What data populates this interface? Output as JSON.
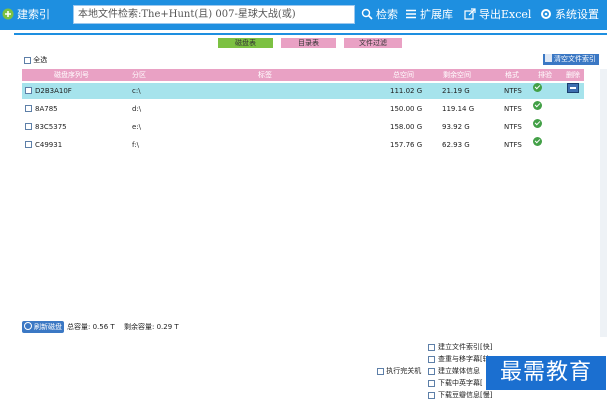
{
  "toolbar": {
    "build_index_label": "建索引",
    "search_value": "本地文件检索:The+Hunt(且) 007-星球大战(或)",
    "search_label": "检索",
    "extensions_label": "扩展库",
    "export_excel_label": "导出Excel",
    "settings_label": "系统设置"
  },
  "tabs": [
    {
      "label": "磁盘表",
      "color": "#7cc142"
    },
    {
      "label": "目录表",
      "color": "#e9a1c4"
    },
    {
      "label": "文件过滤",
      "color": "#e9a1c4"
    }
  ],
  "select_all_label": "全选",
  "clear_index_label": "清空文件索引",
  "table": {
    "headers": [
      "磁盘序列号",
      "分区",
      "标签",
      "总空间",
      "剩余空间",
      "格式",
      "排验",
      "删除"
    ],
    "rows": [
      {
        "serial": "D2B3A10F",
        "partition": "c:\\",
        "label": "",
        "total": "111.02 G",
        "free": "21.19 G",
        "format": "NTFS",
        "selected": true,
        "deletable": true
      },
      {
        "serial": "8A785",
        "partition": "d:\\",
        "label": "",
        "total": "150.00 G",
        "free": "119.14 G",
        "format": "NTFS",
        "selected": false,
        "deletable": false
      },
      {
        "serial": "83C5375",
        "partition": "e:\\",
        "label": "",
        "total": "158.00 G",
        "free": "93.92 G",
        "format": "NTFS",
        "selected": false,
        "deletable": false
      },
      {
        "serial": "C49931",
        "partition": "f:\\",
        "label": "",
        "total": "157.76 G",
        "free": "62.93 G",
        "format": "NTFS",
        "selected": false,
        "deletable": false
      }
    ]
  },
  "footer": {
    "refresh_label": "刷新磁盘",
    "total_capacity": "总容量: 0.56 T",
    "free_capacity": "剩余容量: 0.29 T"
  },
  "options": {
    "shutdown_label": "执行完关机",
    "items": [
      "建立文件索引[快]",
      "查重与移字幕[较",
      "建立媒体信息",
      "下载中英字幕[",
      "下载豆瓣信息[慢]"
    ]
  },
  "watermark": "最需教育",
  "colors": {
    "toolbar": "#1e8fe0",
    "header": "#e9a1c4",
    "selected_row": "#a6e3ec",
    "ok": "#43a047"
  }
}
